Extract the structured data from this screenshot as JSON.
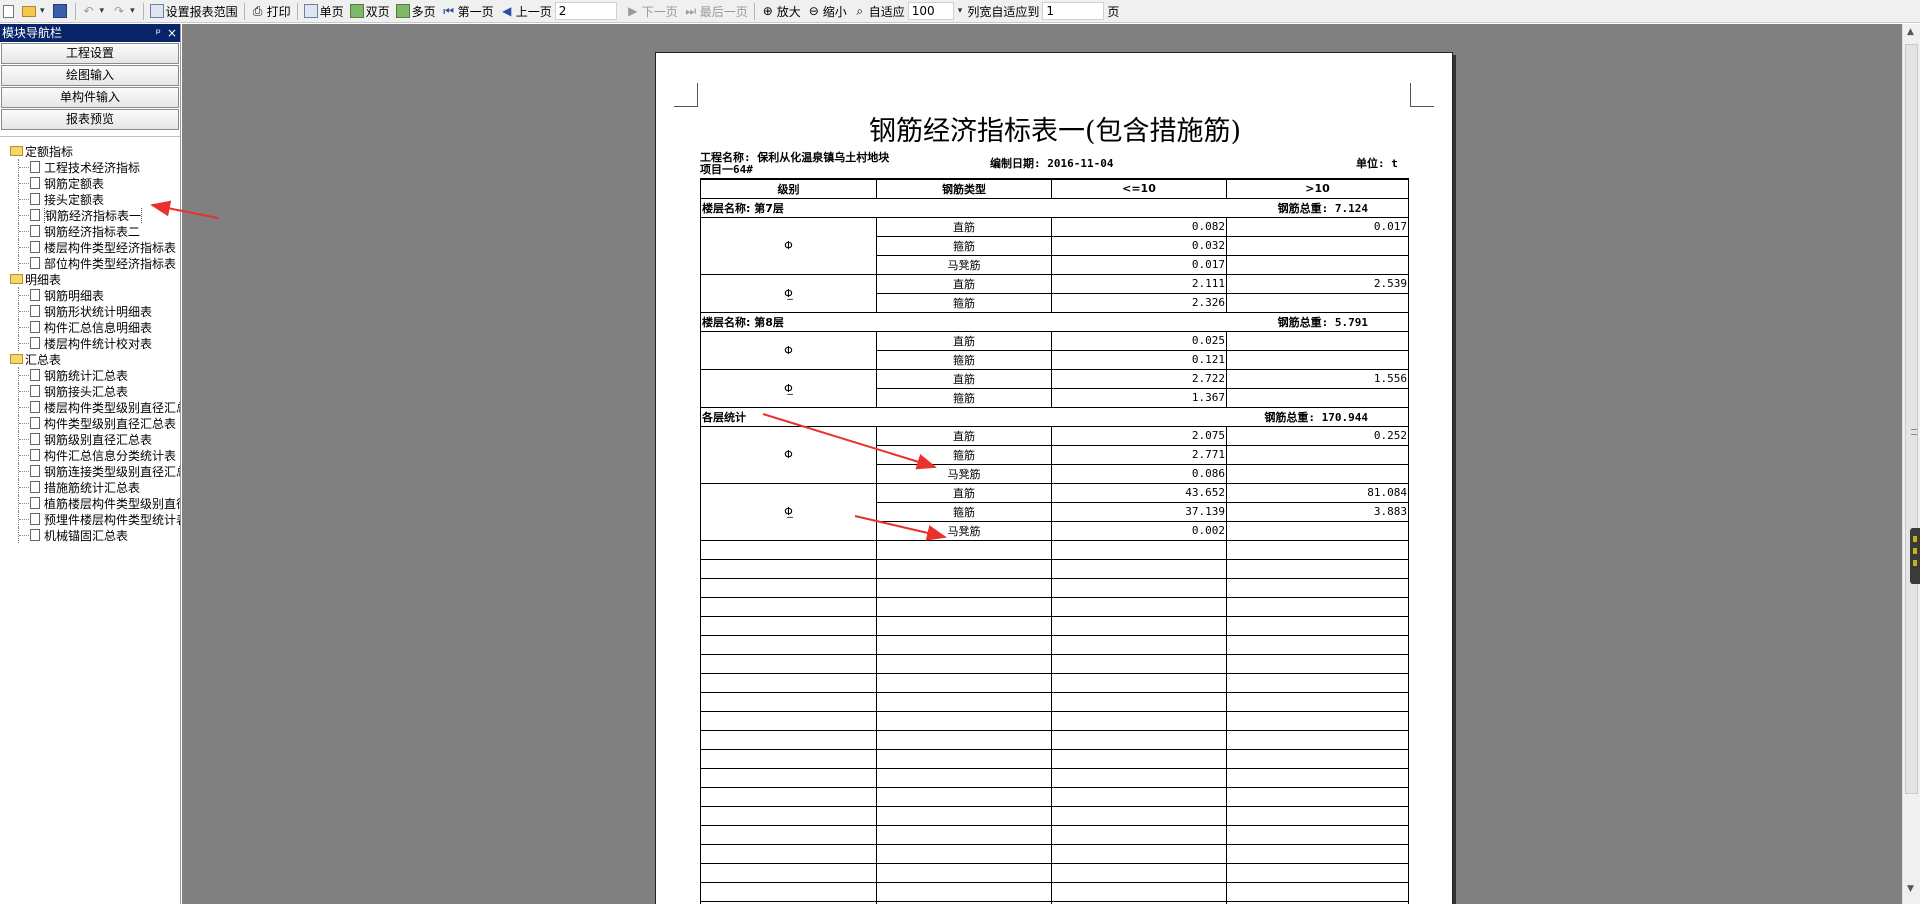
{
  "toolbar": {
    "set_range": "设置报表范围",
    "print": "打印",
    "single": "单页",
    "double": "双页",
    "multi": "多页",
    "first": "第一页",
    "prev": "上一页",
    "page_value": "2",
    "next": "下一页",
    "last": "最后一页",
    "zoom_in": "放大",
    "zoom_out": "缩小",
    "fit": "自适应",
    "zoom_value": "100",
    "col_fit": "列宽自适应到",
    "col_fit_value": "1",
    "page_unit": "页"
  },
  "nav": {
    "title": "模块导航栏",
    "pin": "ᵖ",
    "close": "×",
    "buttons": [
      "工程设置",
      "绘图输入",
      "单构件输入",
      "报表预览"
    ],
    "groups": [
      {
        "label": "定额指标",
        "items": [
          "工程技术经济指标",
          "钢筋定额表",
          "接头定额表",
          "钢筋经济指标表一",
          "钢筋经济指标表二",
          "楼层构件类型经济指标表",
          "部位构件类型经济指标表"
        ]
      },
      {
        "label": "明细表",
        "items": [
          "钢筋明细表",
          "钢筋形状统计明细表",
          "构件汇总信息明细表",
          "楼层构件统计校对表"
        ]
      },
      {
        "label": "汇总表",
        "items": [
          "钢筋统计汇总表",
          "钢筋接头汇总表",
          "楼层构件类型级别直径汇总表",
          "构件类型级别直径汇总表",
          "钢筋级别直径汇总表",
          "构件汇总信息分类统计表",
          "钢筋连接类型级别直径汇总表",
          "措施筋统计汇总表",
          "植筋楼层构件类型级别直径汇总表",
          "预埋件楼层构件类型统计表",
          "机械锚固汇总表"
        ]
      }
    ]
  },
  "report": {
    "title": "钢筋经济指标表一(包含措施筋)",
    "project_label": "工程名称:",
    "project_name": "保利从化温泉镇乌土村地块",
    "project_line2": "项目一64#",
    "date_label": "编制日期:",
    "date": "2016-11-04",
    "unit_label": "单位:",
    "unit": "t",
    "headers": [
      "级别",
      "钢筋类型",
      "<=10",
      ">10"
    ],
    "sections": [
      {
        "floor": "楼层名称: 第7层",
        "total": "钢筋总重: 7.124",
        "grades": [
          {
            "symbol": "Φ",
            "rows": [
              [
                "直筋",
                "0.082",
                "0.017"
              ],
              [
                "箍筋",
                "0.032",
                ""
              ],
              [
                "马凳筋",
                "0.017",
                ""
              ]
            ]
          },
          {
            "symbol": "Φ̲",
            "rows": [
              [
                "直筋",
                "2.111",
                "2.539"
              ],
              [
                "箍筋",
                "2.326",
                ""
              ]
            ]
          }
        ]
      },
      {
        "floor": "楼层名称: 第8层",
        "total": "钢筋总重: 5.791",
        "grades": [
          {
            "symbol": "Φ",
            "rows": [
              [
                "直筋",
                "0.025",
                ""
              ],
              [
                "箍筋",
                "0.121",
                ""
              ]
            ]
          },
          {
            "symbol": "Φ̲",
            "rows": [
              [
                "直筋",
                "2.722",
                "1.556"
              ],
              [
                "箍筋",
                "1.367",
                ""
              ]
            ]
          }
        ]
      },
      {
        "floor": "各层统计",
        "total": "钢筋总重: 170.944",
        "grades": [
          {
            "symbol": "Φ",
            "rows": [
              [
                "直筋",
                "2.075",
                "0.252"
              ],
              [
                "箍筋",
                "2.771",
                ""
              ],
              [
                "马凳筋",
                "0.086",
                ""
              ]
            ]
          },
          {
            "symbol": "Φ̲",
            "rows": [
              [
                "直筋",
                "43.652",
                "81.084"
              ],
              [
                "箍筋",
                "37.139",
                "3.883"
              ],
              [
                "马凳筋",
                "0.002",
                ""
              ]
            ]
          }
        ]
      }
    ],
    "empty_rows": 20
  },
  "colors": {
    "preview_bg": "#808080",
    "nav_title_bg": "#0a246a",
    "annotation": "#e8322b"
  }
}
